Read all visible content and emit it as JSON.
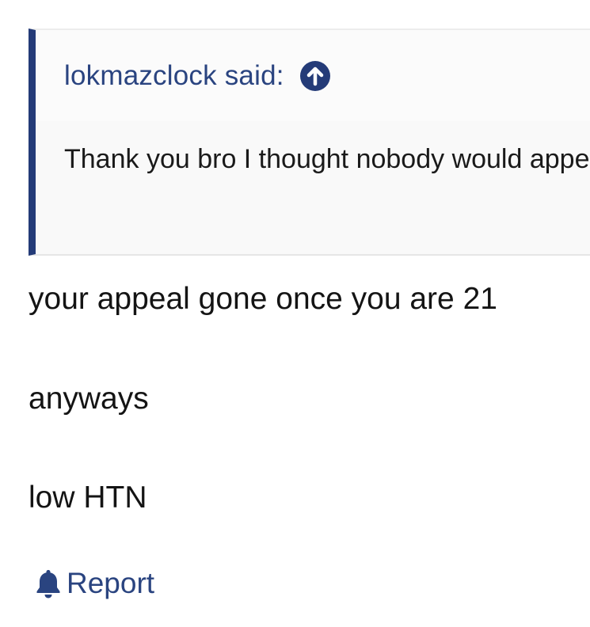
{
  "quote": {
    "author_label": "lokmazclock said:",
    "jump_icon": "arrow-up-circle-icon",
    "text": "Thank you bro I thought nobody would appeal"
  },
  "post": {
    "lines": [
      "your appeal gone once you are 21",
      "anyways",
      "low HTN"
    ]
  },
  "actions": {
    "report_icon": "bell-icon",
    "report_label": "Report"
  },
  "colors": {
    "accent": "#2a4480",
    "quote_border": "#243b78",
    "quote_background": "#f9f9f9",
    "text": "#141414"
  }
}
